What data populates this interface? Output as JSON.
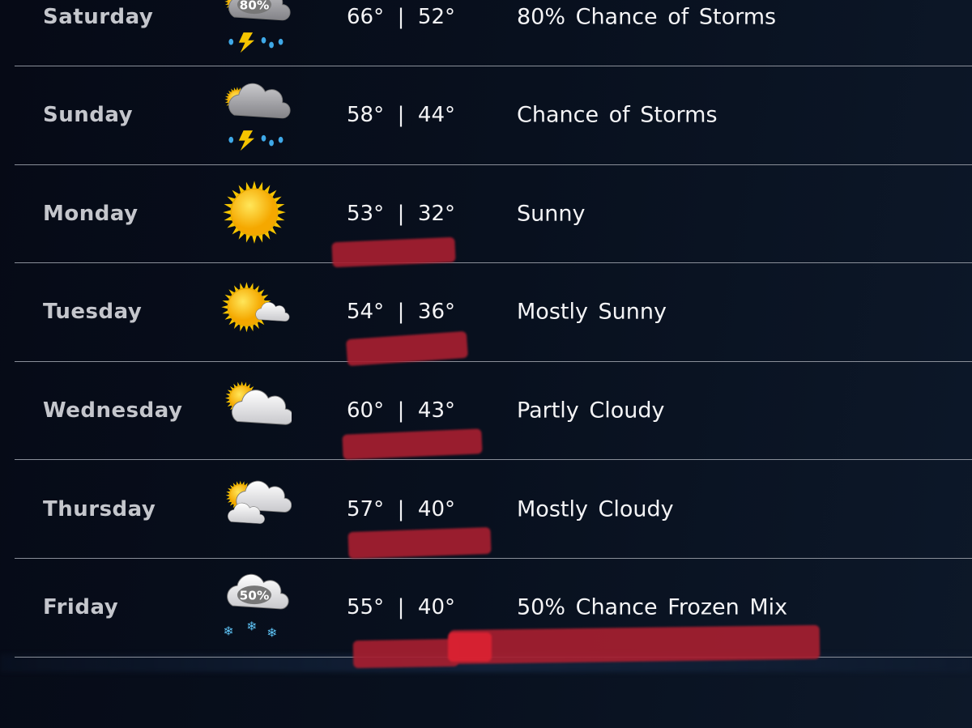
{
  "forecast": [
    {
      "day": "Saturday",
      "icon": "thunderstorm-icon",
      "icon_percent": "80%",
      "high": "66°",
      "low": "52°",
      "condition": "80% Chance of Storms"
    },
    {
      "day": "Sunday",
      "icon": "thunderstorm-icon",
      "icon_percent": "",
      "high": "58°",
      "low": "44°",
      "condition": "Chance of Storms"
    },
    {
      "day": "Monday",
      "icon": "sun-icon",
      "icon_percent": "",
      "high": "53°",
      "low": "32°",
      "condition": "Sunny"
    },
    {
      "day": "Tuesday",
      "icon": "mostly-sunny-icon",
      "icon_percent": "",
      "high": "54°",
      "low": "36°",
      "condition": "Mostly Sunny"
    },
    {
      "day": "Wednesday",
      "icon": "partly-cloudy-icon",
      "icon_percent": "",
      "high": "60°",
      "low": "43°",
      "condition": "Partly Cloudy"
    },
    {
      "day": "Thursday",
      "icon": "mostly-cloudy-icon",
      "icon_percent": "",
      "high": "57°",
      "low": "40°",
      "condition": "Mostly Cloudy"
    },
    {
      "day": "Friday",
      "icon": "frozen-mix-icon",
      "icon_percent": "50%",
      "high": "55°",
      "low": "40°",
      "condition": "50% Chance Frozen Mix"
    }
  ],
  "separator": "|",
  "colors": {
    "background": "#070c19",
    "text": "#f4f4f6",
    "day_text": "#c4c6cc",
    "annotation": "#a61f30"
  }
}
